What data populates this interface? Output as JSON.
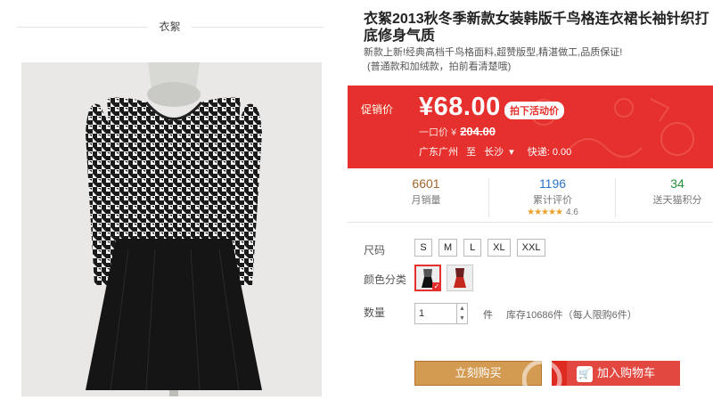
{
  "shop": {
    "name": "衣絮"
  },
  "product": {
    "title": "衣絮2013秋冬季新款女装韩版千鸟格连衣裙长袖针织打底修身气质",
    "subtitle": "新款上新!经典高档千鸟格面料,超赞版型,精湛做工,品质保证!",
    "subtitle2": "(普通款和加绒款，拍前看清楚哦)"
  },
  "price": {
    "label": "促销价",
    "current": "¥68.00",
    "activity_button": "拍下活动价",
    "original_label": "一口价",
    "original_currency": "¥",
    "original_value": "204.00",
    "ship_from": "广东广州",
    "ship_to_word": "至",
    "ship_to": "长沙",
    "ship_dropdown_icon": "chevron-down-icon",
    "delivery": "快递: 0.00"
  },
  "stats": {
    "monthly_sales": "6601",
    "monthly_sales_label": "月销量",
    "reviews": "1196",
    "reviews_label": "累计评价",
    "rating_stars": "★★★★★",
    "rating": "4.6",
    "points": "34",
    "points_label": "送天猫积分"
  },
  "options": {
    "size_label": "尺码",
    "sizes": [
      "S",
      "M",
      "L",
      "XL",
      "XXL"
    ],
    "color_label": "颜色分类",
    "colors": [
      "black-white",
      "red"
    ],
    "selected_color": 0,
    "qty_label": "数量",
    "qty_value": "1",
    "qty_unit": "件",
    "stock_text": "库存10686件（每人限购6件）"
  },
  "actions": {
    "buy_now": "立刻购买",
    "add_to_cart": "加入购物车",
    "cart_icon": "cart-icon"
  },
  "colors": {
    "accent": "#e5302d",
    "buy": "#d39a52",
    "cart": "#dd2b22"
  }
}
